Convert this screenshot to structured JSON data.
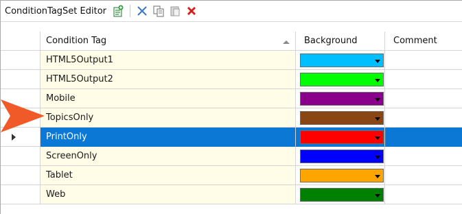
{
  "editor": {
    "title": "ConditionTagSet Editor",
    "toolbar": [
      {
        "name": "new-tag-icon",
        "color": "#2e9a3c"
      },
      {
        "name": "cut-icon",
        "color": "#3a77c4"
      },
      {
        "name": "copy-icon",
        "color": "#6b6b6b"
      },
      {
        "name": "paste-icon",
        "color": "#9a9a9a"
      },
      {
        "name": "delete-icon",
        "color": "#d22020"
      }
    ]
  },
  "grid": {
    "columns": {
      "tag": "Condition Tag",
      "background": "Background",
      "comment": "Comment"
    },
    "rows": [
      {
        "tag": "HTML5Output1",
        "color": "#00BFFF",
        "comment": "",
        "selected": false
      },
      {
        "tag": "HTML5Output2",
        "color": "#00FF00",
        "comment": "",
        "selected": false
      },
      {
        "tag": "Mobile",
        "color": "#8B008B",
        "comment": "",
        "selected": false
      },
      {
        "tag": "TopicsOnly",
        "color": "#8B4513",
        "comment": "",
        "selected": false
      },
      {
        "tag": "PrintOnly",
        "color": "#FF0000",
        "comment": "",
        "selected": true
      },
      {
        "tag": "ScreenOnly",
        "color": "#0000FF",
        "comment": "",
        "selected": false
      },
      {
        "tag": "Tablet",
        "color": "#FFA500",
        "comment": "",
        "selected": false
      },
      {
        "tag": "Web",
        "color": "#008000",
        "comment": "",
        "selected": false
      }
    ]
  },
  "callout": {
    "color": "#f05a28",
    "points_to": "TopicsOnly"
  }
}
